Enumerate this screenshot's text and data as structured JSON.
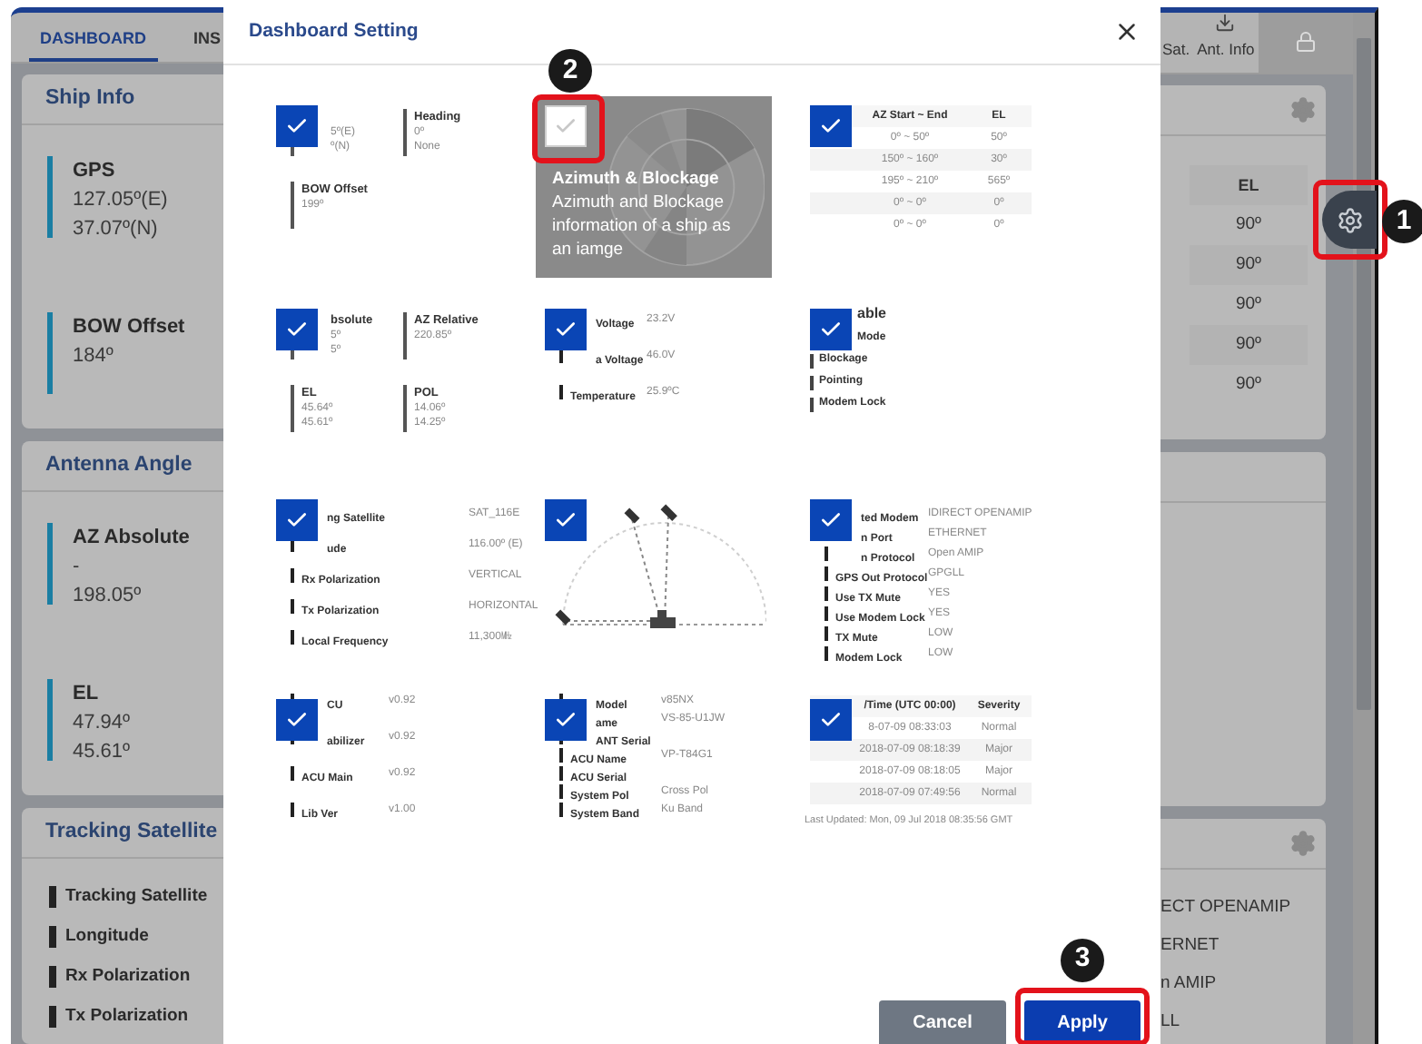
{
  "app": {
    "tabs": [
      {
        "label": "DASHBOARD",
        "selected": true
      },
      {
        "label": "INS",
        "selected": false
      }
    ],
    "right_tabs": [
      {
        "kind": "text",
        "label": "Sat."
      },
      {
        "kind": "icon",
        "label": "Ant. Info"
      },
      {
        "kind": "lock"
      }
    ],
    "left_cards": [
      {
        "kind": "values",
        "title": "Ship Info",
        "items": [
          {
            "label": "GPS",
            "values": [
              "127.05º(E)",
              "37.07º(N)"
            ]
          },
          {
            "label": "BOW Offset",
            "values": [
              "184º"
            ]
          }
        ]
      },
      {
        "kind": "values",
        "title": "Antenna Angle",
        "items": [
          {
            "label": "AZ Absolute",
            "values": [
              "-",
              "198.05º"
            ]
          },
          {
            "label": "EL",
            "values": [
              "47.94º",
              "45.61º"
            ]
          }
        ]
      },
      {
        "kind": "rows",
        "title": "Tracking Satellite",
        "rows": [
          "Tracking Satellite",
          "Longitude",
          "Rx Polarization",
          "Tx Polarization"
        ]
      }
    ],
    "right_cards": [
      {
        "kind": "table",
        "header": "EL",
        "values": [
          "90º",
          "90º",
          "90º",
          "90º",
          "90º"
        ]
      },
      {
        "kind": "empty"
      },
      {
        "kind": "rows",
        "rows": [
          "ECT OPENAMIP",
          "ERNET",
          "n AMIP",
          "LL"
        ]
      }
    ]
  },
  "settings_button": {
    "annotation": "1"
  },
  "dialog": {
    "title": "Dashboard Setting",
    "widgets": [
      {
        "kind": "fields",
        "checked": true,
        "blocks": [
          {
            "values": [
              "5º(E)",
              "º(N)"
            ]
          },
          {
            "label": "Heading",
            "values": [
              "0º",
              "None"
            ]
          },
          {
            "label": "BOW Offset",
            "values": [
              "199º"
            ]
          }
        ]
      },
      {
        "kind": "hover",
        "checked": false,
        "annotation": "2",
        "title": "Azimuth & Blockage",
        "description": "Azimuth and Blockage information of a ship as an iamge"
      },
      {
        "kind": "table",
        "checked": true,
        "columns": [
          "AZ Start ~ End",
          "EL"
        ],
        "rows": [
          [
            "0º ~ 50º",
            "50º"
          ],
          [
            "150º ~ 160º",
            "30º"
          ],
          [
            "195º ~ 210º",
            "565º"
          ],
          [
            "0º ~ 0º",
            "0º"
          ],
          [
            "0º ~ 0º",
            "0º"
          ]
        ]
      },
      {
        "kind": "fields",
        "checked": true,
        "blocks": [
          {
            "label": "bsolute",
            "values": [
              "5º",
              "5º"
            ]
          },
          {
            "label": "AZ Relative",
            "values": [
              "220.85º"
            ]
          },
          {
            "label": "EL",
            "values": [
              "45.64º",
              "45.61º"
            ]
          },
          {
            "label": "POL",
            "values": [
              "14.06º",
              "14.25º"
            ]
          }
        ]
      },
      {
        "kind": "list",
        "checked": true,
        "rows": [
          {
            "label": "Voltage",
            "value": "23.2V"
          },
          {
            "label": "a Voltage",
            "value": "46.0V"
          },
          {
            "label": "Temperature",
            "value": "25.9ºC"
          }
        ]
      },
      {
        "kind": "status",
        "checked": true,
        "heading": "able",
        "items": [
          "Mode",
          "Blockage",
          "Pointing",
          "Modem Lock"
        ]
      },
      {
        "kind": "list",
        "checked": true,
        "rows": [
          {
            "label": "ng Satellite",
            "value": "SAT_116E"
          },
          {
            "label": "ude",
            "value": "116.00º (E)"
          },
          {
            "label": "Rx Polarization",
            "value": "VERTICAL"
          },
          {
            "label": "Tx Polarization",
            "value": "HORIZONTAL"
          },
          {
            "label": "Local Frequency",
            "value": "11,300㎒"
          }
        ]
      },
      {
        "kind": "diagram",
        "checked": true
      },
      {
        "kind": "list",
        "checked": true,
        "rows": [
          {
            "label": "ted Modem",
            "value": "IDIRECT OPENAMIP"
          },
          {
            "label": "n Port",
            "value": "ETHERNET"
          },
          {
            "label": "n Protocol",
            "value": "Open AMIP"
          },
          {
            "label": "GPS Out Protocol",
            "value": "GPGLL"
          },
          {
            "label": "Use TX Mute",
            "value": "YES"
          },
          {
            "label": "Use Modem Lock",
            "value": "YES"
          },
          {
            "label": "TX Mute",
            "value": "LOW"
          },
          {
            "label": "Modem Lock",
            "value": "LOW"
          }
        ]
      },
      {
        "kind": "list",
        "checked": true,
        "rows": [
          {
            "label": "CU",
            "value": "v0.92"
          },
          {
            "label": "abilizer",
            "value": "v0.92"
          },
          {
            "label": "ACU Main",
            "value": "v0.92"
          },
          {
            "label": "Lib Ver",
            "value": "v1.00"
          }
        ]
      },
      {
        "kind": "list",
        "checked": true,
        "rows": [
          {
            "label": "Model",
            "value": "v85NX"
          },
          {
            "label": "ame",
            "value": "VS-85-U1JW"
          },
          {
            "label": "ANT Serial"
          },
          {
            "label": "ACU Name",
            "value": "VP-T84G1"
          },
          {
            "label": "ACU Serial"
          },
          {
            "label": "System Pol",
            "value": "Cross Pol"
          },
          {
            "label": "System Band",
            "value": "Ku Band"
          }
        ]
      },
      {
        "kind": "table",
        "checked": true,
        "columns": [
          "/Time (UTC 00:00)",
          "Severity"
        ],
        "rows": [
          [
            "8-07-09 08:33:03",
            "Normal"
          ],
          [
            "2018-07-09 08:18:39",
            "Major"
          ],
          [
            "2018-07-09 08:18:05",
            "Major"
          ],
          [
            "2018-07-09 07:49:56",
            "Normal"
          ]
        ],
        "footer": "Last Updated: Mon, 09 Jul 2018 08:35:56 GMT"
      }
    ],
    "buttons": [
      {
        "kind": "secondary",
        "label": "Cancel"
      },
      {
        "kind": "primary",
        "label": "Apply",
        "annotation": "3"
      }
    ]
  }
}
